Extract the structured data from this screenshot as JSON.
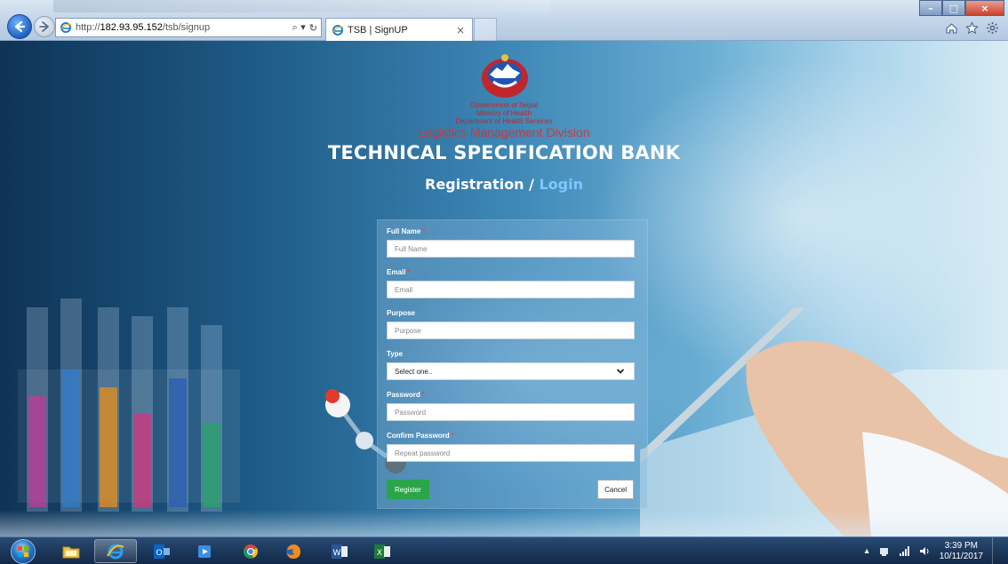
{
  "browser": {
    "url_prefix": "http://",
    "url_host": "182.93.95.152",
    "url_path": "/tsb/signup",
    "search_glyph": "⌕ ▾",
    "refresh_glyph": "↻",
    "tab_title": "TSB | SignUP",
    "tab_close": "×",
    "window_controls": {
      "minimize": "–",
      "maximize": "□",
      "close": "×"
    },
    "icons": [
      "home-icon",
      "favorites-star-icon",
      "settings-gear-icon"
    ]
  },
  "header": {
    "org_government": "Government of Nepal",
    "org_ministry": "Ministry of Health",
    "org_department": "Department of Health Services",
    "org_division": "Logistics Management Division",
    "site_title": "TECHNICAL SPECIFICATION BANK",
    "registration_label": "Registration",
    "separator": " / ",
    "login_label": "Login"
  },
  "form": {
    "full_name": {
      "label": "Full Name",
      "required_mark": "*",
      "placeholder": "Full Name"
    },
    "email": {
      "label": "Email",
      "required_mark": "*",
      "placeholder": "Email"
    },
    "purpose": {
      "label": "Purpose",
      "placeholder": "Purpose"
    },
    "type": {
      "label": "Type",
      "selected": "Select one.."
    },
    "password": {
      "label": "Password",
      "required_mark": "*",
      "placeholder": "Password"
    },
    "confirm_password": {
      "label": "Confirm Password",
      "required_mark": "*",
      "placeholder": "Repeat password"
    },
    "register_label": "Register",
    "cancel_label": "Cancel"
  },
  "taskbar": {
    "apps": [
      "windows-start-icon",
      "file-explorer-icon",
      "internet-explorer-icon",
      "outlook-icon",
      "media-player-icon",
      "chrome-icon",
      "firefox-icon",
      "word-icon",
      "excel-icon"
    ],
    "tray_arrow": "▴",
    "time": "3:39 PM",
    "date": "10/11/2017"
  },
  "colors": {
    "accent_red": "#c0262b",
    "register_green": "#2aa54a",
    "login_link": "#7fc8ff"
  }
}
